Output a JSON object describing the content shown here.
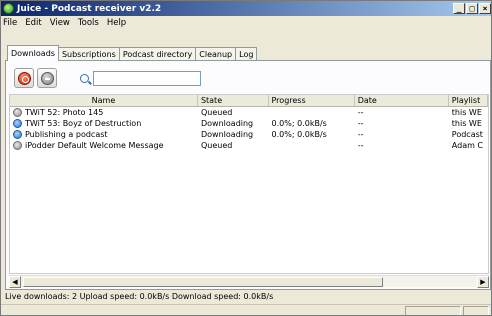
{
  "window": {
    "title": "Juice - Podcast receiver v2.2",
    "controls": {
      "minimize": "_",
      "maximize": "□",
      "close": "×"
    }
  },
  "menu": [
    "File",
    "Edit",
    "View",
    "Tools",
    "Help"
  ],
  "tabs": [
    "Downloads",
    "Subscriptions",
    "Podcast directory",
    "Cleanup",
    "Log"
  ],
  "active_tab": "Downloads",
  "toolbar": {
    "cancel_icon": "cancel-icon",
    "remove_icon": "remove-icon",
    "search_icon": "search-icon",
    "search_value": ""
  },
  "table": {
    "columns": [
      "Name",
      "State",
      "Progress",
      "Date",
      "Playlist"
    ],
    "rows": [
      {
        "icon": "queued",
        "name": "TWiT 52: Photo 145",
        "state": "Queued",
        "progress": "",
        "date": "--",
        "playlist": "this WE"
      },
      {
        "icon": "downloading",
        "name": "TWiT 53: Boyz of Destruction",
        "state": "Downloading",
        "progress": "0.0%; 0.0kB/s",
        "date": "--",
        "playlist": "this WE"
      },
      {
        "icon": "downloading",
        "name": "Publishing a podcast",
        "state": "Downloading",
        "progress": "0.0%; 0.0kB/s",
        "date": "--",
        "playlist": "Podcast"
      },
      {
        "icon": "queued",
        "name": "iPodder Default Welcome Message",
        "state": "Queued",
        "progress": "",
        "date": "--",
        "playlist": "Adam C"
      }
    ]
  },
  "status_text": "Live downloads: 2 Upload speed: 0.0kB/s Download speed: 0.0kB/s",
  "colors": {
    "titlebar_start": "#0a246a",
    "titlebar_end": "#a6caf0",
    "downloading": "#2a78d4"
  }
}
